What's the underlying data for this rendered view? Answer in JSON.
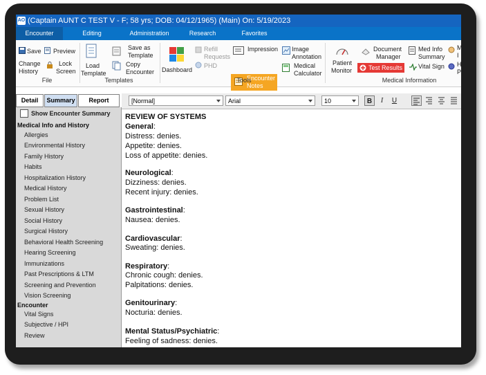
{
  "title_bar": {
    "app_icon_text": "AO",
    "text": "(Captain AUNT C TEST V - F; 58 yrs; DOB: 04/12/1965) (Main) On: 5/19/2023"
  },
  "menu_tabs": [
    "Encounter",
    "Editing",
    "Administration",
    "Research",
    "Favorites"
  ],
  "ribbon": {
    "file": {
      "save": "Save",
      "preview": "Preview",
      "change_history": [
        "Change",
        "History"
      ],
      "lock_screen": [
        "Lock",
        "Screen"
      ],
      "group": "File"
    },
    "templates": {
      "load_template": [
        "Load",
        "Template"
      ],
      "save_as_template": [
        "Save as",
        "Template"
      ],
      "copy_encounter": [
        "Copy",
        "Encounter"
      ],
      "group": "Templates"
    },
    "tools": {
      "dashboard": "Dashboard",
      "refill_requests": [
        "Refill",
        "Requests"
      ],
      "phd": "PHD",
      "impression": "Impression",
      "image_annotation": [
        "Image",
        "Annotation"
      ],
      "encounter_notes": [
        "Encounter",
        "Notes"
      ],
      "medical_calculator": [
        "Medical",
        "Calculator"
      ],
      "group": "Tools"
    },
    "medical_information": {
      "patient_monitor": [
        "Patient",
        "Monitor"
      ],
      "document_manager": [
        "Document",
        "Manager"
      ],
      "test_results": "Test Results",
      "med_info_summary": [
        "Med Info",
        "Summary"
      ],
      "vital_sign": "Vital Sign",
      "extra_1": [
        "M",
        "I"
      ],
      "extra_2": [
        "H",
        "P"
      ],
      "group": "Medical Information"
    }
  },
  "side_tabs": [
    "Detail",
    "Summary",
    "Report"
  ],
  "sidebar": {
    "show_summary_label": "Show Encounter Summary",
    "medical_info_header": "Medical Info and History",
    "medical_info_items": [
      "Allergies",
      "Environmental History",
      "Family History",
      "Habits",
      "Hospitalization History",
      "Medical History",
      "Problem List",
      "Sexual History",
      "Social History",
      "Surgical History",
      "Behavioral Health Screening",
      "Hearing Screening",
      "Immunizations",
      "Past Prescriptions & LTM",
      "Screening and Prevention",
      "Vision Screening"
    ],
    "encounter_header": "Encounter",
    "encounter_items": [
      "Vital Signs",
      "Subjective / HPI",
      "Review"
    ]
  },
  "format_toolbar": {
    "style": "[Normal]",
    "font": "Arial",
    "size": "10",
    "bold": "B",
    "italic": "I",
    "underline": "U"
  },
  "document": {
    "heading": "REVIEW OF SYSTEMS",
    "sections": [
      {
        "title": "General",
        "items": [
          "Distress: denies.",
          "Appetite: denies.",
          "Loss of appetite: denies."
        ]
      },
      {
        "title": "Neurological",
        "items": [
          "Dizziness: denies.",
          "Recent injury: denies."
        ]
      },
      {
        "title": "Gastrointestinal",
        "items": [
          "Nausea: denies."
        ]
      },
      {
        "title": "Cardiovascular",
        "items": [
          "Sweating: denies."
        ]
      },
      {
        "title": "Respiratory",
        "items": [
          "Chronic cough: denies.",
          "Palpitations: denies."
        ]
      },
      {
        "title": "Genitourinary",
        "items": [
          "Nocturia: denies."
        ]
      },
      {
        "title": "Mental Status/Psychiatric",
        "items": [
          "Feeling of sadness: denies."
        ]
      }
    ]
  },
  "colors": {
    "title_bar": "#1565c0",
    "menu_bar": "#0a73c8",
    "highlight_orange": "#f5a623",
    "highlight_red": "#e53935"
  }
}
